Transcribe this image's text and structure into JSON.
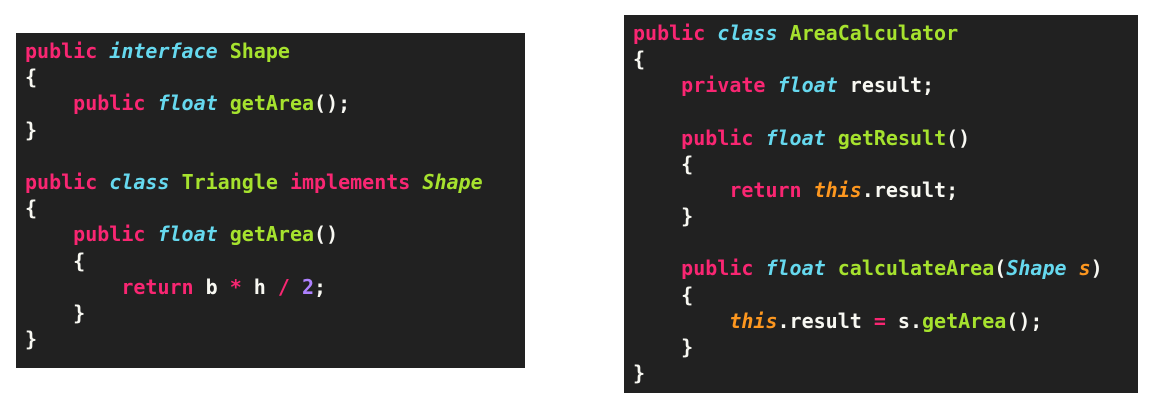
{
  "left_panel": {
    "lines": [
      [
        {
          "t": "public",
          "c": "keyword"
        },
        {
          "t": " ",
          "c": "plain"
        },
        {
          "t": "interface",
          "c": "type"
        },
        {
          "t": " ",
          "c": "plain"
        },
        {
          "t": "Shape",
          "c": "name"
        }
      ],
      [
        {
          "t": "{",
          "c": "plain"
        }
      ],
      [
        {
          "t": "    ",
          "c": "plain"
        },
        {
          "t": "public",
          "c": "keyword"
        },
        {
          "t": " ",
          "c": "plain"
        },
        {
          "t": "float",
          "c": "type"
        },
        {
          "t": " ",
          "c": "plain"
        },
        {
          "t": "getArea",
          "c": "name"
        },
        {
          "t": "();",
          "c": "plain"
        }
      ],
      [
        {
          "t": "}",
          "c": "plain"
        }
      ],
      [],
      [
        {
          "t": "public",
          "c": "keyword"
        },
        {
          "t": " ",
          "c": "plain"
        },
        {
          "t": "class",
          "c": "type"
        },
        {
          "t": " ",
          "c": "plain"
        },
        {
          "t": "Triangle",
          "c": "name"
        },
        {
          "t": " ",
          "c": "plain"
        },
        {
          "t": "implements",
          "c": "keyword"
        },
        {
          "t": " ",
          "c": "plain"
        },
        {
          "t": "Shape",
          "c": "iface"
        }
      ],
      [
        {
          "t": "{",
          "c": "plain"
        }
      ],
      [
        {
          "t": "    ",
          "c": "plain"
        },
        {
          "t": "public",
          "c": "keyword"
        },
        {
          "t": " ",
          "c": "plain"
        },
        {
          "t": "float",
          "c": "type"
        },
        {
          "t": " ",
          "c": "plain"
        },
        {
          "t": "getArea",
          "c": "name"
        },
        {
          "t": "()",
          "c": "plain"
        }
      ],
      [
        {
          "t": "    {",
          "c": "plain"
        }
      ],
      [
        {
          "t": "        ",
          "c": "plain"
        },
        {
          "t": "return",
          "c": "keyword"
        },
        {
          "t": " b ",
          "c": "plain"
        },
        {
          "t": "*",
          "c": "operator"
        },
        {
          "t": " h ",
          "c": "plain"
        },
        {
          "t": "/",
          "c": "operator"
        },
        {
          "t": " ",
          "c": "plain"
        },
        {
          "t": "2",
          "c": "number"
        },
        {
          "t": ";",
          "c": "plain"
        }
      ],
      [
        {
          "t": "    }",
          "c": "plain"
        }
      ],
      [
        {
          "t": "}",
          "c": "plain"
        }
      ]
    ]
  },
  "right_panel": {
    "lines": [
      [
        {
          "t": "public",
          "c": "keyword"
        },
        {
          "t": " ",
          "c": "plain"
        },
        {
          "t": "class",
          "c": "type"
        },
        {
          "t": " ",
          "c": "plain"
        },
        {
          "t": "AreaCalculator",
          "c": "name"
        }
      ],
      [
        {
          "t": "{",
          "c": "plain"
        }
      ],
      [
        {
          "t": "    ",
          "c": "plain"
        },
        {
          "t": "private",
          "c": "keyword"
        },
        {
          "t": " ",
          "c": "plain"
        },
        {
          "t": "float",
          "c": "type"
        },
        {
          "t": " result;",
          "c": "plain"
        }
      ],
      [],
      [
        {
          "t": "    ",
          "c": "plain"
        },
        {
          "t": "public",
          "c": "keyword"
        },
        {
          "t": " ",
          "c": "plain"
        },
        {
          "t": "float",
          "c": "type"
        },
        {
          "t": " ",
          "c": "plain"
        },
        {
          "t": "getResult",
          "c": "name"
        },
        {
          "t": "()",
          "c": "plain"
        }
      ],
      [
        {
          "t": "    {",
          "c": "plain"
        }
      ],
      [
        {
          "t": "        ",
          "c": "plain"
        },
        {
          "t": "return",
          "c": "keyword"
        },
        {
          "t": " ",
          "c": "plain"
        },
        {
          "t": "this",
          "c": "this"
        },
        {
          "t": ".result;",
          "c": "plain"
        }
      ],
      [
        {
          "t": "    }",
          "c": "plain"
        }
      ],
      [],
      [
        {
          "t": "    ",
          "c": "plain"
        },
        {
          "t": "public",
          "c": "keyword"
        },
        {
          "t": " ",
          "c": "plain"
        },
        {
          "t": "float",
          "c": "type"
        },
        {
          "t": " ",
          "c": "plain"
        },
        {
          "t": "calculateArea",
          "c": "name"
        },
        {
          "t": "(",
          "c": "plain"
        },
        {
          "t": "Shape",
          "c": "type"
        },
        {
          "t": " ",
          "c": "plain"
        },
        {
          "t": "s",
          "c": "param"
        },
        {
          "t": ")",
          "c": "plain"
        }
      ],
      [
        {
          "t": "    {",
          "c": "plain"
        }
      ],
      [
        {
          "t": "        ",
          "c": "plain"
        },
        {
          "t": "this",
          "c": "this"
        },
        {
          "t": ".result ",
          "c": "plain"
        },
        {
          "t": "=",
          "c": "operator"
        },
        {
          "t": " s.",
          "c": "plain"
        },
        {
          "t": "getArea",
          "c": "name"
        },
        {
          "t": "();",
          "c": "plain"
        }
      ],
      [
        {
          "t": "    }",
          "c": "plain"
        }
      ],
      [
        {
          "t": "}",
          "c": "plain"
        }
      ]
    ]
  }
}
